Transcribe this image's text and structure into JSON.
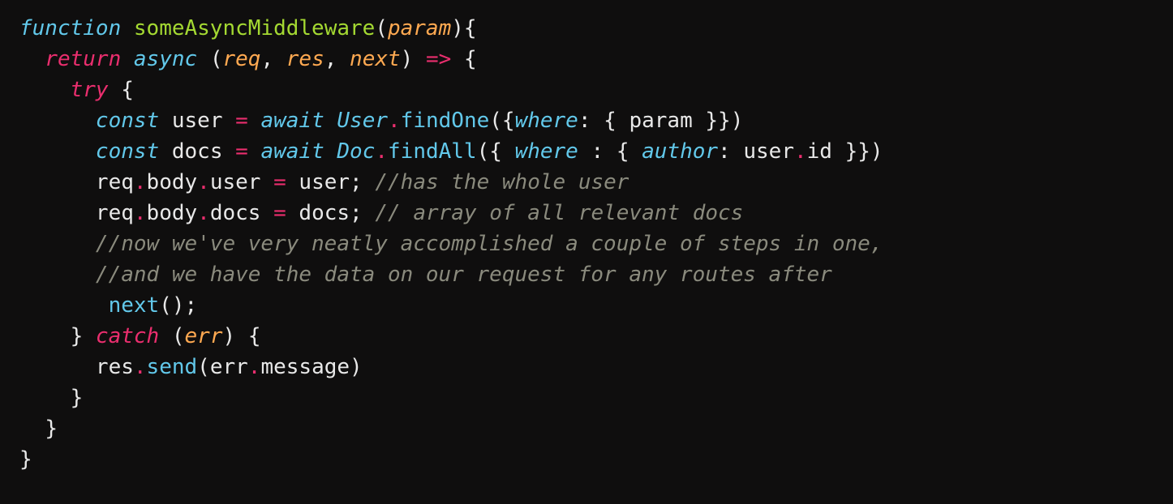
{
  "code": {
    "kw_function": "function",
    "fn_name": "someAsyncMiddleware",
    "param_outer": "param",
    "kw_return": "return",
    "kw_async": "async",
    "param_req": "req",
    "param_res": "res",
    "param_next": "next",
    "arrow": "=>",
    "kw_try": "try",
    "kw_const1": "const",
    "var_user": "user",
    "kw_await1": "await",
    "cls_user": "User",
    "m_findOne": "findOne",
    "key_where1": "where",
    "key_param": "param",
    "kw_const2": "const",
    "var_docs": "docs",
    "kw_await2": "await",
    "cls_doc": "Doc",
    "m_findAll": "findAll",
    "key_where2": "where",
    "key_author": "author",
    "prop_user": "user",
    "prop_id": "id",
    "stmt_req1a": "req",
    "stmt_body1": "body",
    "stmt_user1": "user",
    "stmt_userR": "user",
    "cmt1": "//has the whole user",
    "stmt_req2a": "req",
    "stmt_body2": "body",
    "stmt_docs2": "docs",
    "stmt_docsR": "docs",
    "cmt2": "// array of all relevant docs",
    "cmt3": "//now we've very neatly accomplished a couple of steps in one,",
    "cmt4": "//and we have the data on our request for any routes after",
    "call_next": "next",
    "kw_catch": "catch",
    "param_err": "err",
    "stmt_res": "res",
    "m_send": "send",
    "err2": "err",
    "prop_message": "message"
  }
}
